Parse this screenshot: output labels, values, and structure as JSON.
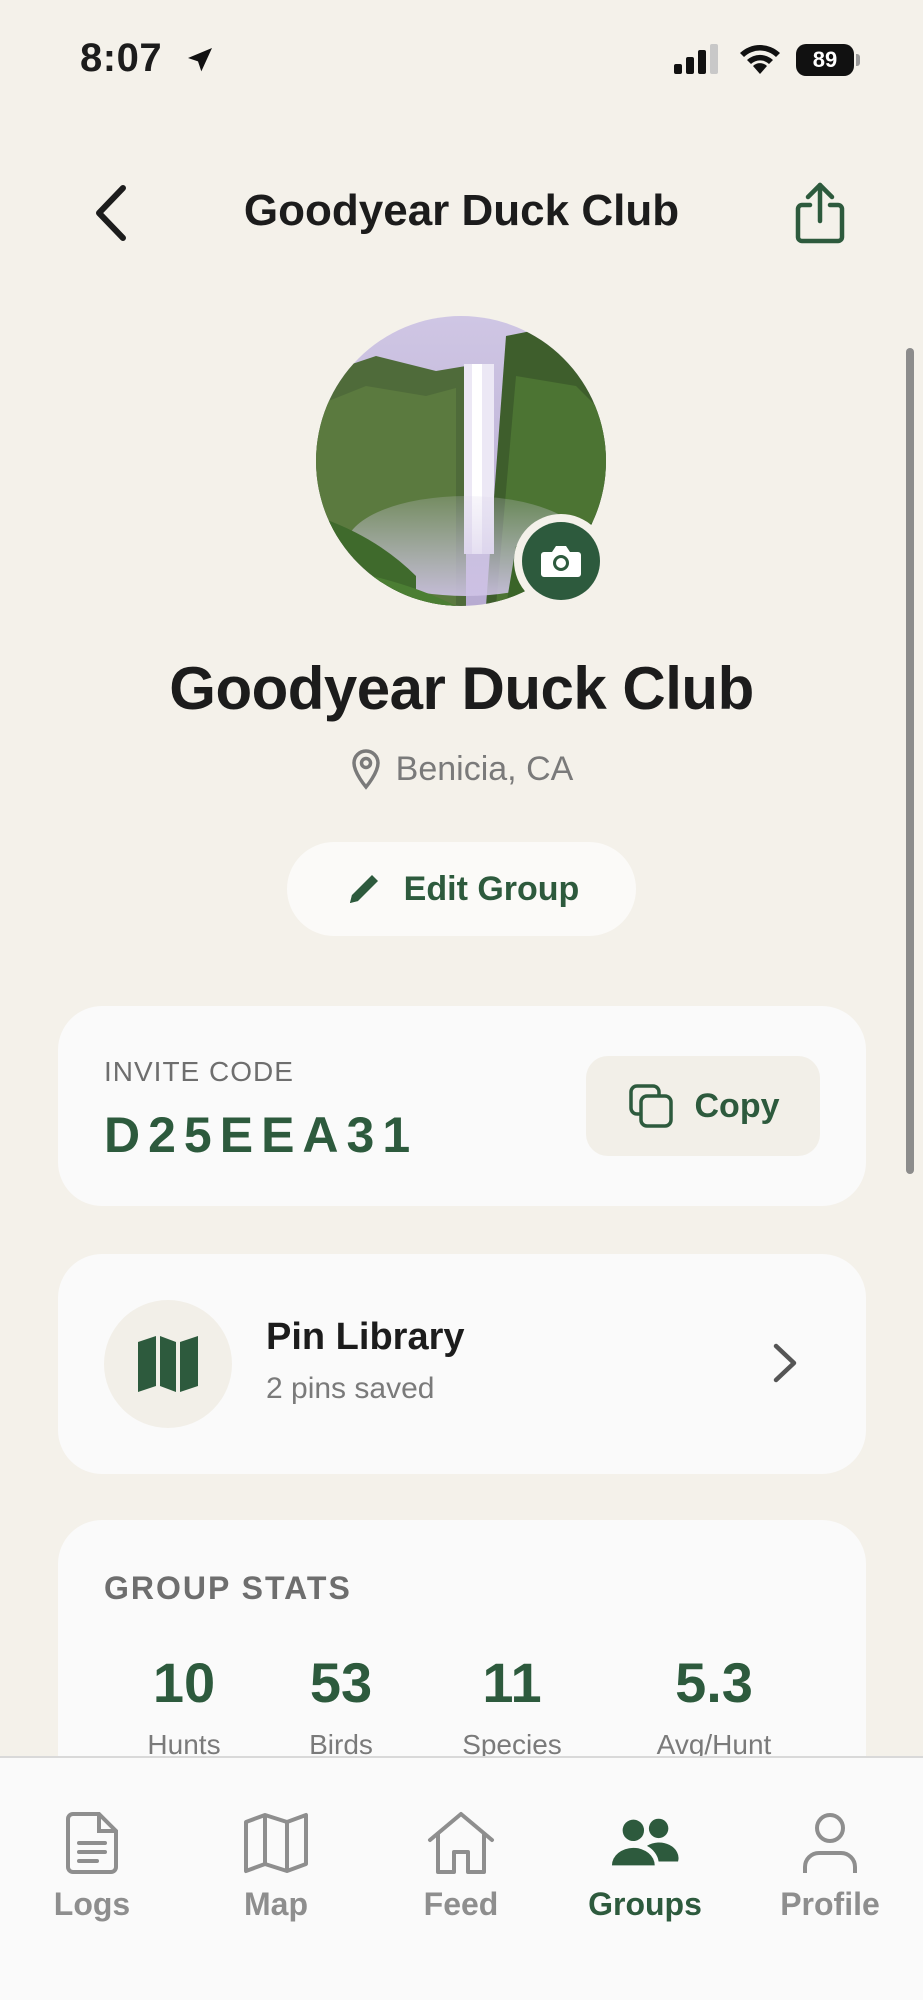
{
  "status_bar": {
    "time": "8:07",
    "battery": "89"
  },
  "header": {
    "title": "Goodyear Duck Club",
    "back_icon": "chevron-left-icon",
    "share_icon": "share-icon"
  },
  "group": {
    "name": "Goodyear Duck Club",
    "location": "Benicia, CA",
    "avatar_description_icon": "waterfall-photo",
    "edit_label": "Edit Group"
  },
  "invite": {
    "label": "INVITE CODE",
    "code": "D25EEA31",
    "copy_label": "Copy"
  },
  "pin_library": {
    "title": "Pin Library",
    "subtitle": "2 pins saved"
  },
  "stats": {
    "label": "GROUP STATS",
    "items": [
      {
        "value": "10",
        "label": "Hunts"
      },
      {
        "value": "53",
        "label": "Birds"
      },
      {
        "value": "11",
        "label": "Species"
      },
      {
        "value": "5.3",
        "label": "Avg/Hunt"
      }
    ]
  },
  "tabs": [
    {
      "label": "Logs",
      "icon": "document-icon"
    },
    {
      "label": "Map",
      "icon": "map-icon"
    },
    {
      "label": "Feed",
      "icon": "home-icon"
    },
    {
      "label": "Groups",
      "icon": "people-icon",
      "active": true
    },
    {
      "label": "Profile",
      "icon": "person-icon"
    }
  ],
  "colors": {
    "accent": "#2d5a3d",
    "background": "#f4f1ea",
    "card": "#fafafa"
  }
}
